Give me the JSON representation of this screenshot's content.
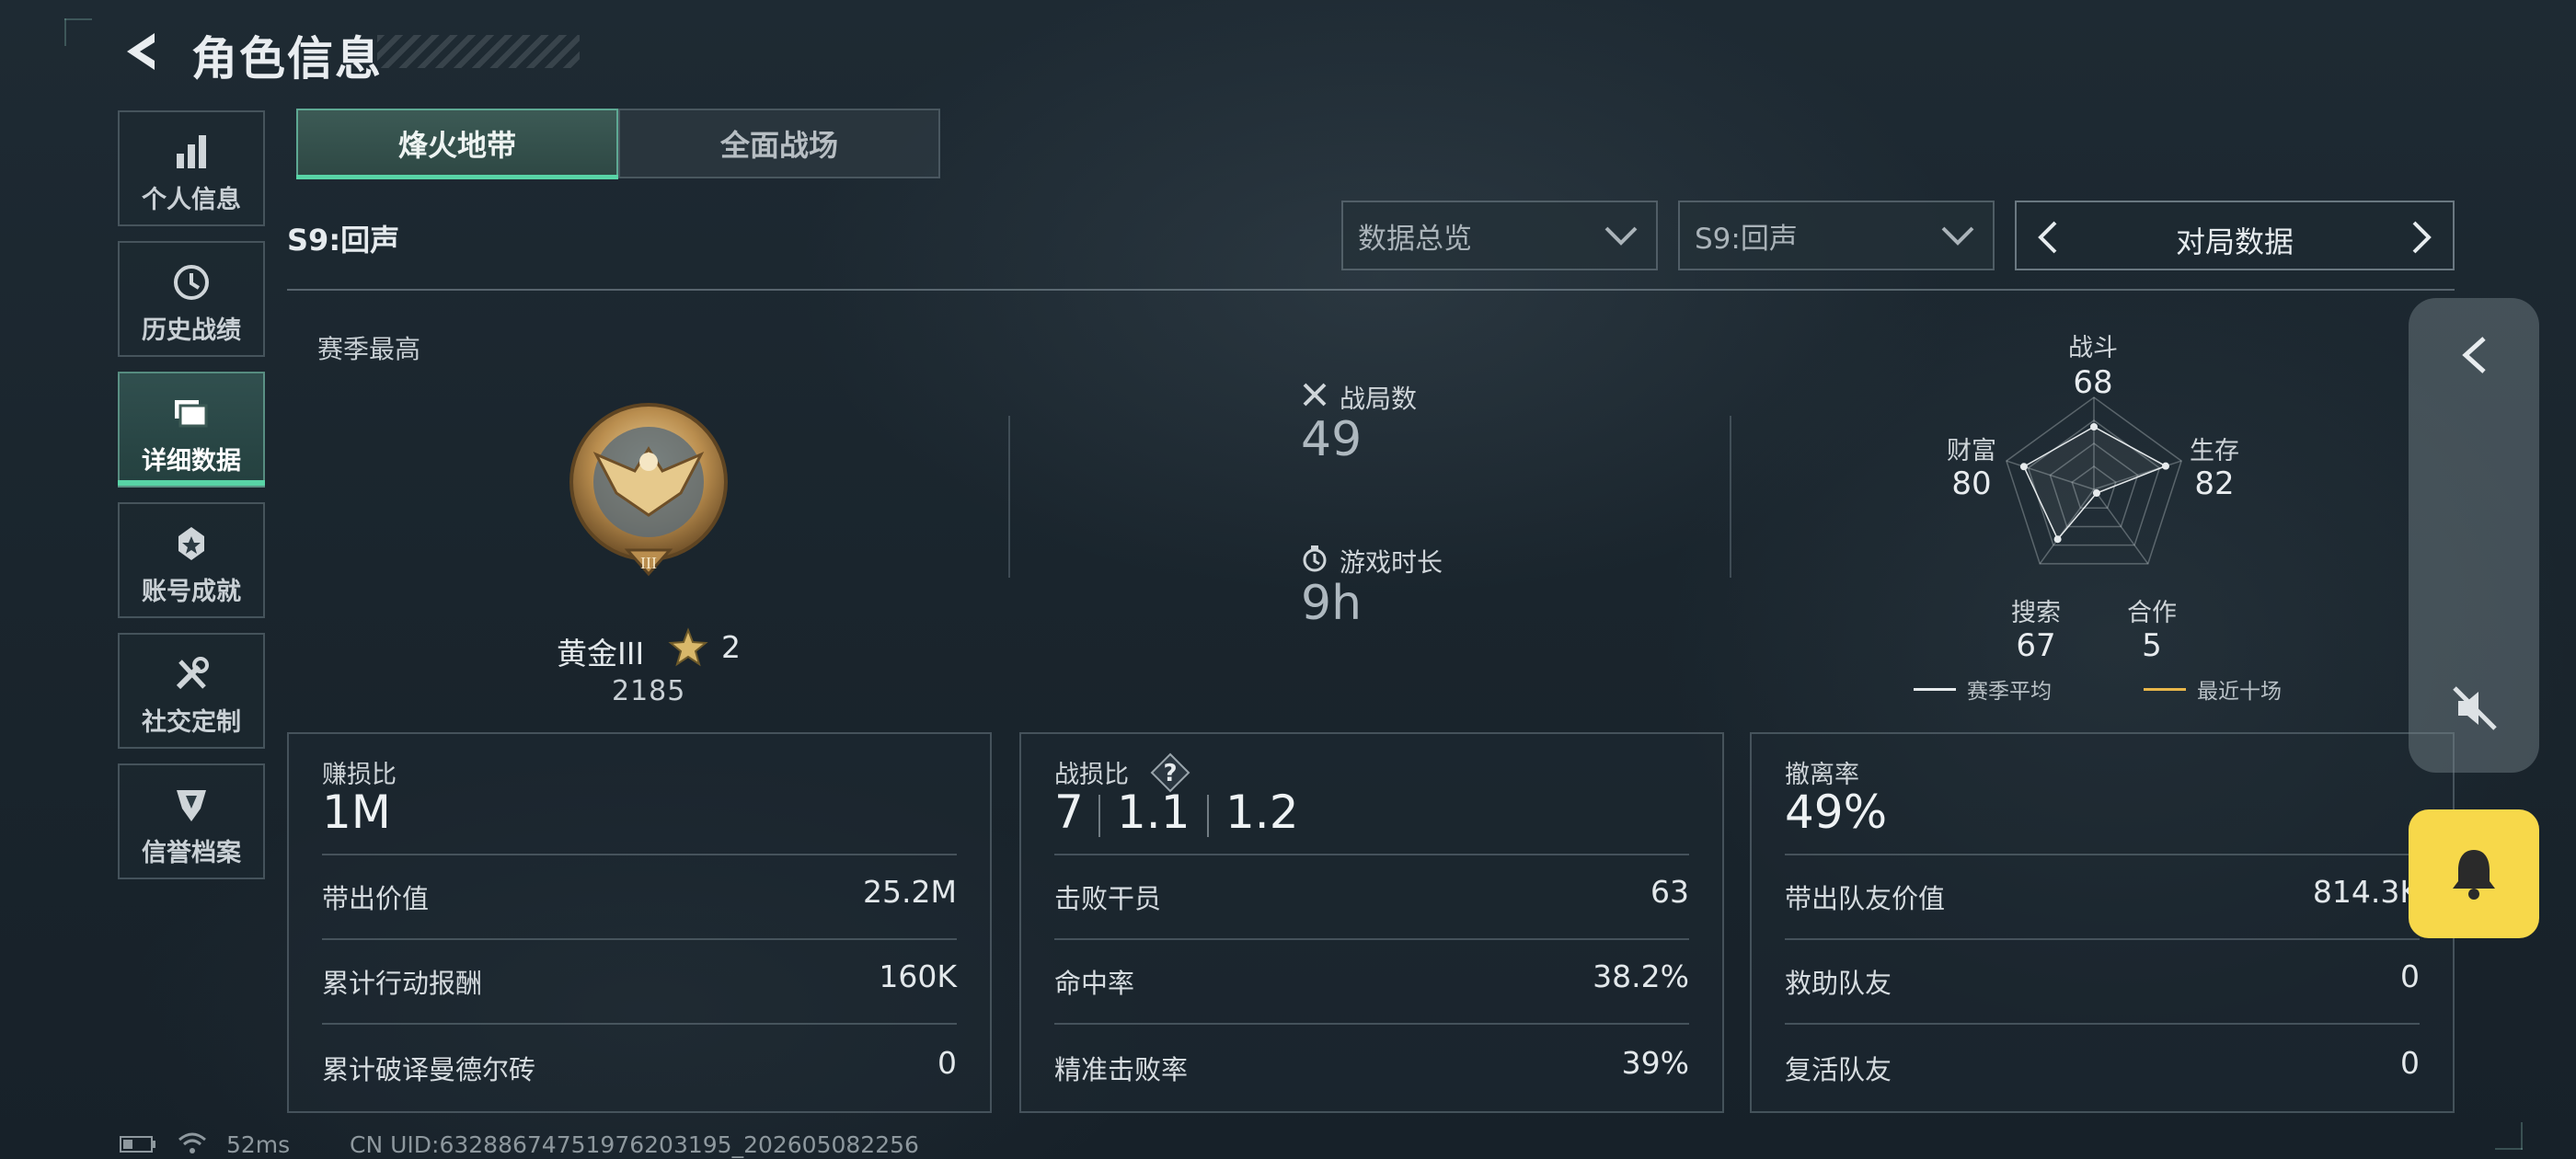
{
  "header": {
    "title": "角色信息"
  },
  "sidebar": {
    "items": [
      {
        "label": "个人信息",
        "icon": "bar-chart-icon"
      },
      {
        "label": "历史战绩",
        "icon": "clock-icon"
      },
      {
        "label": "详细数据",
        "icon": "cards-icon",
        "active": true
      },
      {
        "label": "账号成就",
        "icon": "medal-icon"
      },
      {
        "label": "社交定制",
        "icon": "tools-icon"
      },
      {
        "label": "信誉档案",
        "icon": "shield-icon"
      }
    ]
  },
  "mode_tabs": [
    {
      "label": "烽火地带",
      "active": true
    },
    {
      "label": "全面战场",
      "active": false
    }
  ],
  "season": {
    "label": "S9:回声"
  },
  "filters": {
    "data_type": "数据总览",
    "season": "S9:回声",
    "pager_label": "对局数据"
  },
  "overview": {
    "season_best_label": "赛季最高",
    "rank": {
      "name": "黄金III",
      "stars": "2",
      "score": "2185"
    },
    "matches": {
      "label": "战局数",
      "value": "49"
    },
    "playtime": {
      "label": "游戏时长",
      "value": "9h"
    }
  },
  "radar": {
    "axes": [
      {
        "label": "战斗",
        "value": "68"
      },
      {
        "label": "生存",
        "value": "82"
      },
      {
        "label": "合作",
        "value": "5"
      },
      {
        "label": "搜索",
        "value": "67"
      },
      {
        "label": "财富",
        "value": "80"
      }
    ],
    "legend": [
      {
        "label": "赛季平均",
        "color": "#e6eaec"
      },
      {
        "label": "最近十场",
        "color": "#e8b64a"
      }
    ]
  },
  "cards": [
    {
      "title": "赚损比",
      "big": "1M",
      "rows": [
        {
          "label": "带出价值",
          "value": "25.2M"
        },
        {
          "label": "累计行动报酬",
          "value": "160K"
        },
        {
          "label": "累计破译曼德尔砖",
          "value": "0"
        }
      ]
    },
    {
      "title": "战损比",
      "big_parts": [
        "7",
        "1.1",
        "1.2"
      ],
      "rows": [
        {
          "label": "击败干员",
          "value": "63"
        },
        {
          "label": "命中率",
          "value": "38.2%"
        },
        {
          "label": "精准击败率",
          "value": "39%"
        }
      ]
    },
    {
      "title": "撤离率",
      "big": "49%",
      "rows": [
        {
          "label": "带出队友价值",
          "value": "814.3K"
        },
        {
          "label": "救助队友",
          "value": "0"
        },
        {
          "label": "复活队友",
          "value": "0"
        }
      ]
    }
  ],
  "status": {
    "ping": "52ms",
    "uid": "CN UID:6328867475197620319​5_202605082256"
  },
  "colors": {
    "accent": "#58d4a6",
    "bell": "#f7d84a"
  }
}
